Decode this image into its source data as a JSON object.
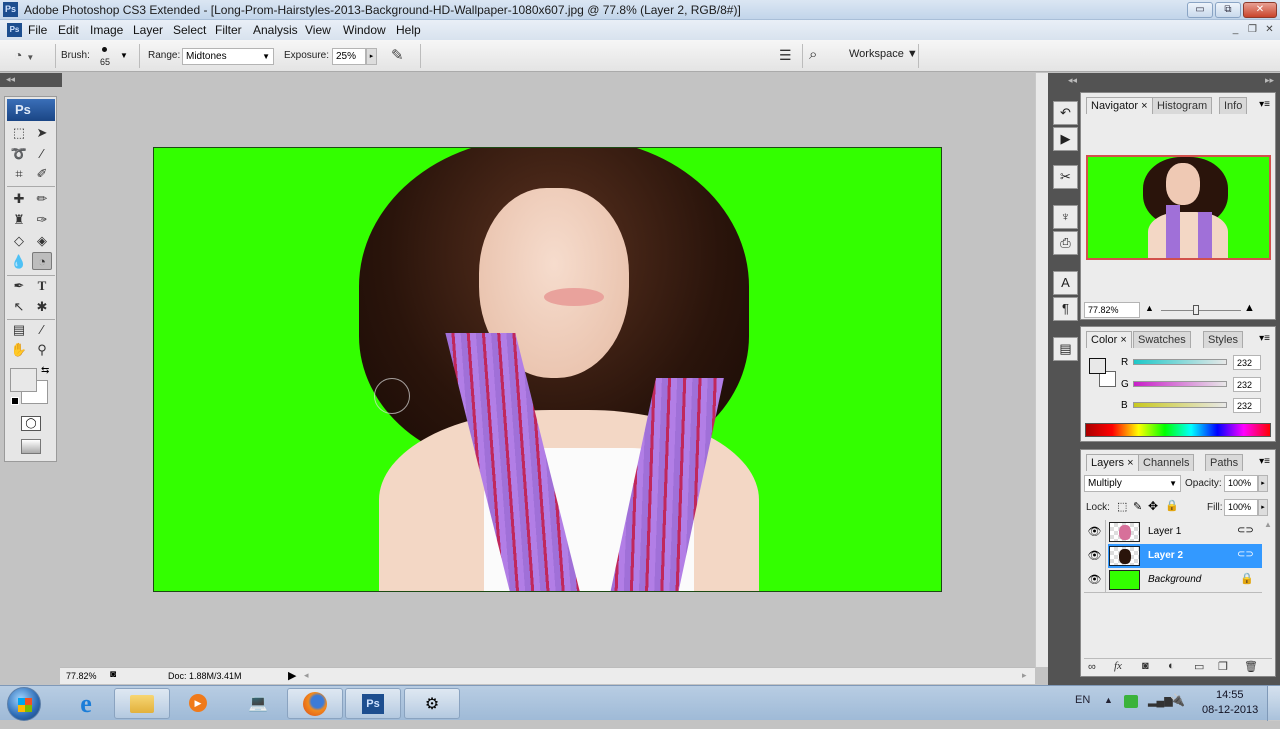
{
  "window": {
    "title": "Adobe Photoshop CS3 Extended - [Long-Prom-Hairstyles-2013-Background-HD-Wallpaper-1080x607.jpg @ 77.8% (Layer 2, RGB/8#)]",
    "app_icon": "Ps",
    "minimize": "▭",
    "restore": "⧉",
    "close": "✕",
    "doc_minimize": "_",
    "doc_restore": "❐",
    "doc_close": "✕"
  },
  "menu": [
    "File",
    "Edit",
    "Image",
    "Layer",
    "Select",
    "Filter",
    "Analysis",
    "View",
    "Window",
    "Help"
  ],
  "options_bar": {
    "tool_icon": "dodge-tool-icon",
    "brush_label": "Brush:",
    "brush_size": "65",
    "range_label": "Range:",
    "range_value": "Midtones",
    "exposure_label": "Exposure:",
    "exposure_value": "25%",
    "workspace_label": "Workspace ▼"
  },
  "toolbox": {
    "logo": "Ps",
    "tools": [
      "marquee",
      "move",
      "lasso",
      "magic-wand",
      "crop",
      "slice",
      "healing-brush",
      "brush",
      "clone-stamp",
      "history-brush",
      "eraser",
      "paint-bucket",
      "blur",
      "dodge",
      "pen",
      "type",
      "path-selection",
      "custom-shape",
      "notes",
      "eyedropper",
      "hand",
      "zoom"
    ],
    "selected_tool": "dodge"
  },
  "status": {
    "zoom": "77.82%",
    "doc": "Doc: 1.88M/3.41M"
  },
  "navigator": {
    "tabs": [
      "Navigator",
      "Histogram",
      "Info"
    ],
    "active_tab": "Navigator",
    "zoom": "77.82%"
  },
  "color": {
    "tabs": [
      "Color",
      "Swatches",
      "Styles"
    ],
    "active_tab": "Color",
    "channels": [
      {
        "label": "R",
        "value": "232"
      },
      {
        "label": "G",
        "value": "232"
      },
      {
        "label": "B",
        "value": "232"
      }
    ],
    "foreground": "#e8e8e8",
    "background": "#ffffff"
  },
  "layers": {
    "tabs": [
      "Layers",
      "Channels",
      "Paths"
    ],
    "active_tab": "Layers",
    "blend_mode": "Multiply",
    "opacity_label": "Opacity:",
    "opacity": "100%",
    "lock_label": "Lock:",
    "fill_label": "Fill:",
    "fill": "100%",
    "items": [
      {
        "name": "Layer 1",
        "selected": false,
        "badge": "link-icon"
      },
      {
        "name": "Layer 2",
        "selected": true,
        "badge": "link-icon"
      },
      {
        "name": "Background",
        "selected": false,
        "badge": "lock-icon"
      }
    ]
  },
  "canvas": {
    "background_color": "#33ff00"
  },
  "taskbar": {
    "apps": [
      "Internet Explorer",
      "Windows Explorer",
      "Windows Media Player",
      "Network",
      "Firefox",
      "Photoshop",
      "Utility"
    ],
    "language": "EN",
    "time": "14:55",
    "date": "08-12-2013"
  }
}
